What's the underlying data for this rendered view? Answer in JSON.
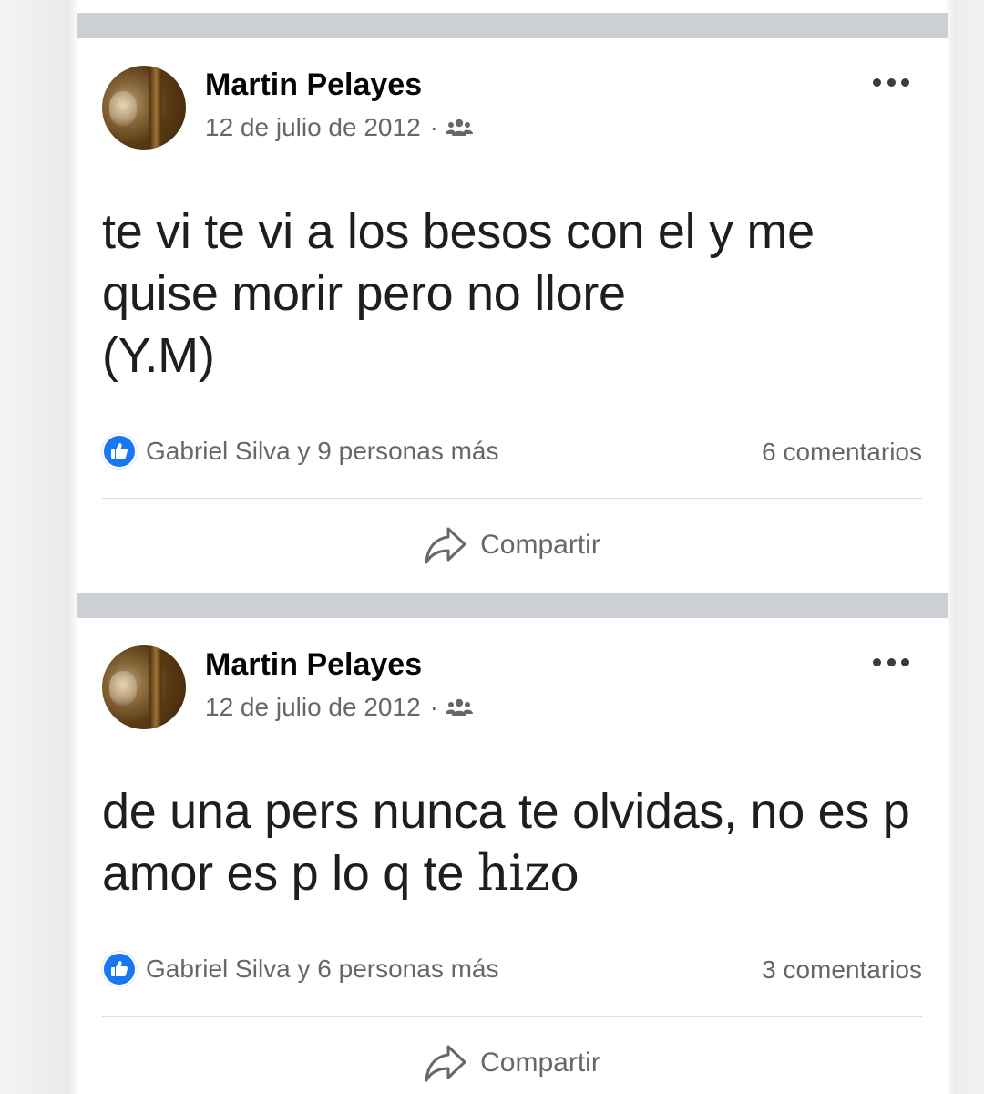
{
  "posts": [
    {
      "author": "Martin Pelayes",
      "date": "12 de julio de 2012",
      "separator": "·",
      "privacy_icon": "friends-icon",
      "text_lines": [
        "te vi te vi a los besos con el y me",
        "quise morir pero no llore",
        "(Y.M)"
      ],
      "reactions_text": "Gabriel Silva y 9 personas más",
      "comments": "6 comentarios",
      "share_label": "Compartir"
    },
    {
      "author": "Martin Pelayes",
      "date": "12 de julio de 2012",
      "separator": "·",
      "privacy_icon": "friends-icon",
      "text_line1": "de una pers nunca te olvidas, no es p",
      "text_line2_a": "amor es p lo q te ",
      "text_line2_b": "hizo",
      "reactions_text": "Gabriel Silva y 6 personas más",
      "comments": "3 comentarios",
      "share_label": "Compartir"
    }
  ],
  "colors": {
    "like_blue": "#1877f2",
    "secondary_text": "#65676b",
    "divider_band": "#ccd0d5"
  }
}
